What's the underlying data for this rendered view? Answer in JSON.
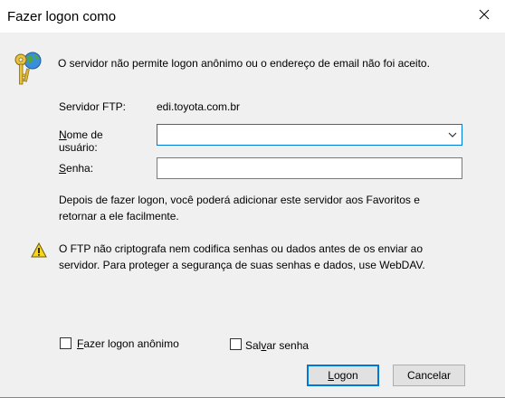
{
  "window": {
    "title": "Fazer logon como",
    "close_glyph": "✕"
  },
  "message": {
    "icon": "keys-globe-icon",
    "text": "O servidor não permite logon anônimo ou o endereço de email não foi aceito."
  },
  "server": {
    "label": "Servidor FTP:",
    "value": "edi.toyota.com.br"
  },
  "username": {
    "label_first_char": "N",
    "label_rest_line1": "ome de",
    "label_line2": "usuário:",
    "value": ""
  },
  "password": {
    "label_first_char": "S",
    "label_rest": "enha:",
    "value": ""
  },
  "info": {
    "line1": "Depois de fazer logon, você poderá adicionar este servidor aos Favoritos e",
    "line2": "retornar a ele facilmente."
  },
  "warning": {
    "icon": "warning-icon",
    "line1": "O FTP não criptografa nem codifica senhas ou dados antes de os enviar ao",
    "line2": "servidor. Para proteger a segurança de suas senhas e dados, use WebDAV."
  },
  "anonymous": {
    "label_first_char": "F",
    "label_rest": "azer logon anônimo",
    "checked": false
  },
  "save_password": {
    "label_pre": "Sal",
    "label_u": "v",
    "label_rest": "ar senha",
    "checked": false
  },
  "buttons": {
    "logon_first_char": "L",
    "logon_rest": "ogon",
    "cancel": "Cancelar"
  },
  "colors": {
    "accent": "#0078d7",
    "dialog_bg": "#f0f0f0",
    "button_bg": "#e1e1e1"
  }
}
